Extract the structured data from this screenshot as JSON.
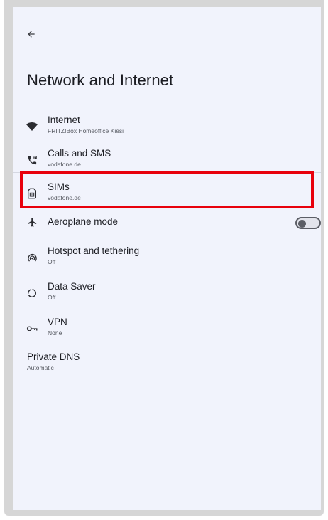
{
  "header": {
    "back_icon": "arrow-back-icon",
    "title": "Network and Internet"
  },
  "items": [
    {
      "icon": "wifi-icon",
      "label": "Internet",
      "sub": "FRITZ!Box Homeoffice Kiesi"
    },
    {
      "icon": "calls-sms-icon",
      "label": "Calls and SMS",
      "sub": "vodafone.de"
    },
    {
      "icon": "sim-card-icon",
      "label": "SIMs",
      "sub": "vodafone.de"
    },
    {
      "icon": "airplane-icon",
      "label": "Aeroplane mode",
      "toggle_on": false
    },
    {
      "icon": "hotspot-icon",
      "label": "Hotspot and tethering",
      "sub": "Off"
    },
    {
      "icon": "data-saver-icon",
      "label": "Data Saver",
      "sub": "Off"
    },
    {
      "icon": "vpn-key-icon",
      "label": "VPN",
      "sub": "None"
    }
  ],
  "private_dns": {
    "label": "Private DNS",
    "sub": "Automatic"
  },
  "colors": {
    "highlight": "#e8000c",
    "screen_bg": "#f1f3fc",
    "text": "#1b1c22"
  }
}
